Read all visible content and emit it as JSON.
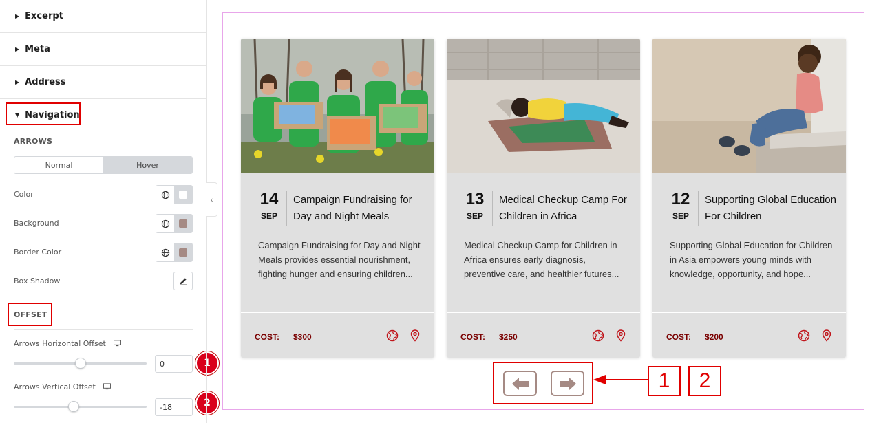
{
  "panel": {
    "sections": [
      {
        "label": "Excerpt"
      },
      {
        "label": "Meta"
      },
      {
        "label": "Address"
      },
      {
        "label": "Navigation"
      }
    ],
    "arrows_heading": "ARROWS",
    "tabs": [
      "Normal",
      "Hover"
    ],
    "active_tab": "Hover",
    "controls": [
      {
        "label": "Color",
        "swatch": "#ffffff"
      },
      {
        "label": "Background",
        "swatch": "#a58a84"
      },
      {
        "label": "Border Color",
        "swatch": "#a58a84"
      },
      {
        "label": "Box Shadow"
      }
    ],
    "offset_heading": "OFFSET",
    "horizontal": {
      "label": "Arrows Horizontal Offset",
      "value": "0",
      "slider_fraction": 0.5,
      "badge": "1"
    },
    "vertical": {
      "label": "Arrows Vertical Offset",
      "value": "-18",
      "slider_fraction": 0.45,
      "badge": "2"
    }
  },
  "cards": [
    {
      "day": "14",
      "month": "SEP",
      "title": "Campaign Fundraising for Day and Night Meals",
      "description": "Campaign Fundraising for Day and Night Meals provides essential nourishment, fighting hunger and ensuring children...",
      "cost_label": "COST:",
      "cost_value": "$300",
      "image": "volunteers-donation-boxes"
    },
    {
      "day": "13",
      "month": "SEP",
      "title": "Medical Checkup Camp For Children in Africa",
      "description": "Medical Checkup Camp for Children in Africa ensures early diagnosis, preventive care, and healthier futures...",
      "cost_label": "COST:",
      "cost_value": "$250",
      "image": "child-sleeping-on-ground"
    },
    {
      "day": "12",
      "month": "SEP",
      "title": "Supporting Global Education For Children",
      "description": "Supporting Global Education for Children in Asia empowers young minds with knowledge, opportunity, and hope...",
      "cost_label": "COST:",
      "cost_value": "$200",
      "image": "child-sitting-on-step"
    }
  ],
  "callouts": [
    "1",
    "2"
  ],
  "colors": {
    "accent": "#e00000",
    "arrow": "#a58a84",
    "cost": "#7a0000",
    "card_bg": "#e0e0e0"
  }
}
